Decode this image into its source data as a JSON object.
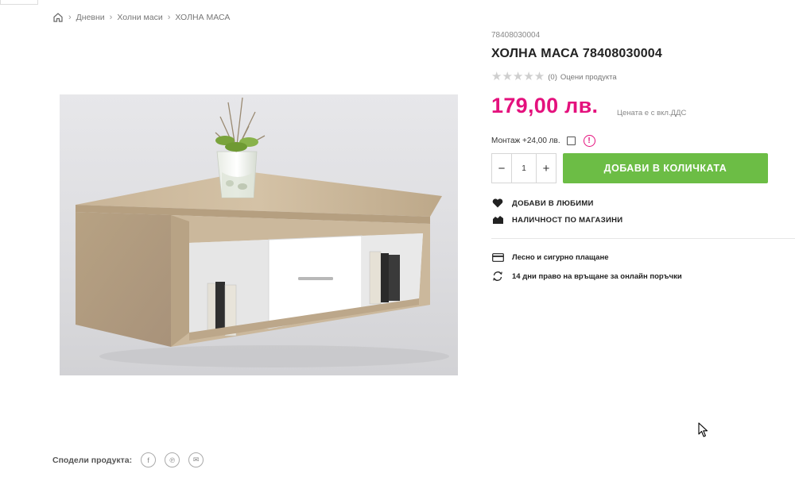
{
  "breadcrumb": {
    "items": [
      "Дневни",
      "Холни маси",
      "ХОЛНА МАСА"
    ]
  },
  "product": {
    "sku": "78408030004",
    "title": "ХОЛНА МАСА 78408030004",
    "rating_count": "(0)",
    "rate_label": "Оцени продукта",
    "price": "179,00 лв.",
    "vat_note": "Цената е с вкл.ДДС",
    "assembly_label": "Монтаж +24,00 лв.",
    "assembly_info": "!",
    "quantity": "1"
  },
  "buttons": {
    "minus": "−",
    "plus": "+",
    "add_to_cart": "ДОБАВИ В КОЛИЧКАТА"
  },
  "actions": {
    "favorites": "ДОБАВИ В ЛЮБИМИ",
    "availability": "НАЛИЧНОСТ ПО МАГАЗИНИ"
  },
  "features": {
    "payment": "Лесно и сигурно плащане",
    "returns": "14 дни право на връщане за онлайн поръчки"
  },
  "share": {
    "label": "Сподели продукта:",
    "facebook": "f",
    "pinterest": "℗",
    "email": "✉"
  },
  "icons": {
    "home": "home-icon",
    "heart": "heart-icon",
    "store": "store-icon",
    "card": "credit-card-icon",
    "return": "return-icon"
  },
  "colors": {
    "price": "#e4117d",
    "button": "#6cbd45"
  },
  "rating": {
    "value": 0,
    "max": 5
  }
}
